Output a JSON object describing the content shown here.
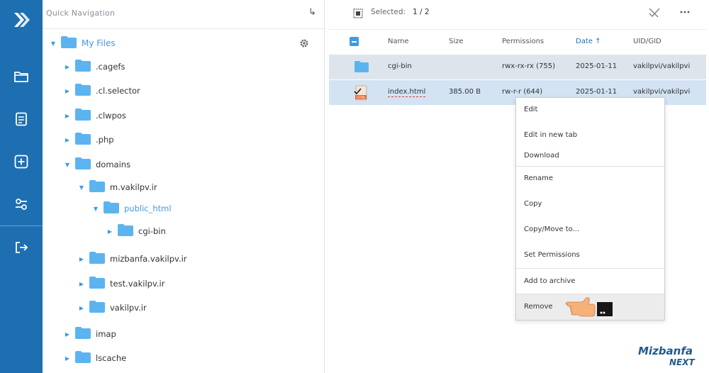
{
  "sidebar": {
    "items": [
      {
        "icon": "logo-icon"
      },
      {
        "icon": "folder-icon"
      },
      {
        "icon": "document-icon"
      },
      {
        "icon": "add-icon"
      },
      {
        "icon": "connections-icon"
      },
      {
        "icon": "logout-icon"
      }
    ]
  },
  "tree": {
    "title": "Quick Navigation",
    "exit_glyph": "↳",
    "root_label": "My Files",
    "nodes": [
      {
        "label": ".cagefs"
      },
      {
        "label": ".cl.selector"
      },
      {
        "label": ".clwpos"
      },
      {
        "label": ".php"
      },
      {
        "label": "domains"
      },
      {
        "label": "m.vakilpv.ir"
      },
      {
        "label": "public_html"
      },
      {
        "label": "cgi-bin"
      },
      {
        "label": "mizbanfa.vakilpv.ir"
      },
      {
        "label": "test.vakilpv.ir"
      },
      {
        "label": "vakilpv.ir"
      },
      {
        "label": "imap"
      },
      {
        "label": "lscache"
      }
    ]
  },
  "toolbar": {
    "selected_label": "Selected:",
    "selected_count": "1 / 2"
  },
  "table": {
    "columns": [
      "Name",
      "Size",
      "Permissions",
      "Date ↑",
      "UID/GID"
    ],
    "rows": [
      {
        "name": "cgi-bin",
        "size": "",
        "permissions": "rwx-rx-rx (755)",
        "date": "2025-01-11",
        "uid": "vakilpvi/vakilpvi"
      },
      {
        "name": "index.html",
        "size": "385.00 B",
        "permissions": "rw-r-r (644)",
        "date": "2025-01-11",
        "uid": "vakilpvi/vakilpvi"
      }
    ]
  },
  "context_menu": {
    "items": [
      "Edit",
      "Edit in new tab",
      "Download",
      "Rename",
      "Copy",
      "Copy/Move to...",
      "Set Permissions",
      "Add to archive",
      "Remove"
    ]
  },
  "watermark": {
    "brand": "Mizbanfa",
    "sub": "NEXT"
  },
  "colors": {
    "accent": "#1e6fb2",
    "folder": "#5bb4f0",
    "selected_row": "#d3e3f4"
  }
}
